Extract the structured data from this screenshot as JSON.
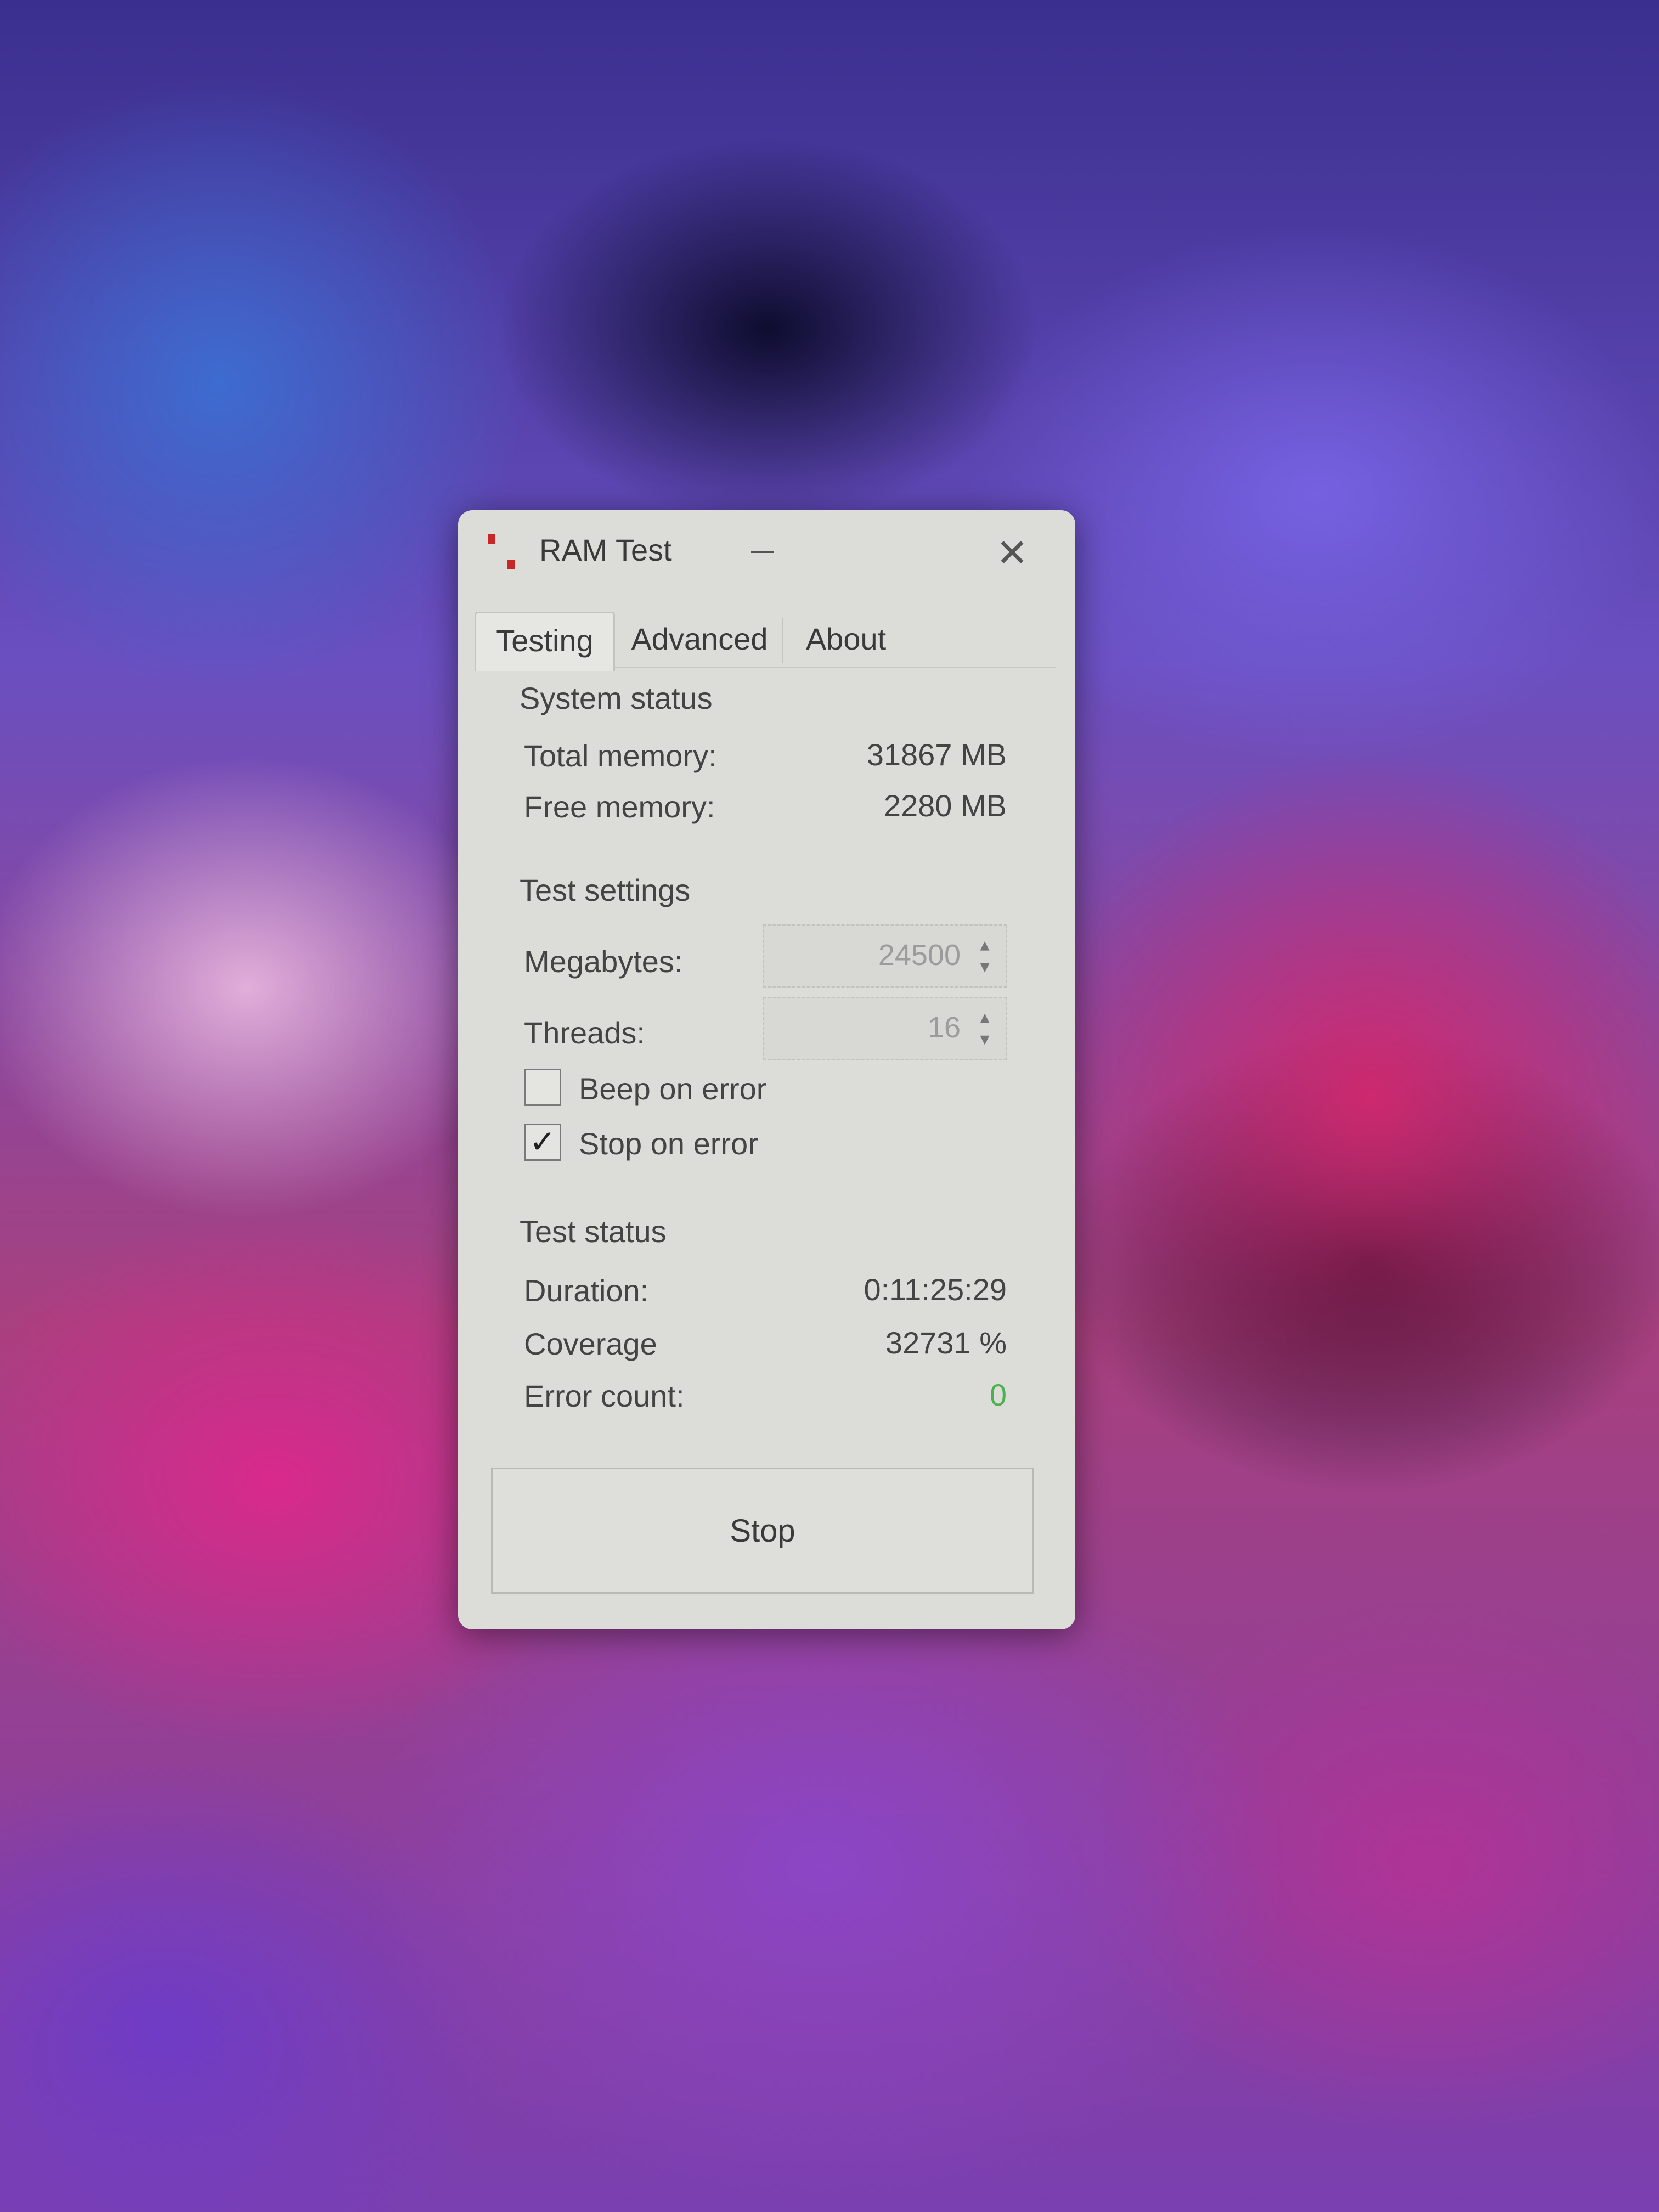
{
  "window": {
    "title": "RAM Test",
    "close_glyph": "✕"
  },
  "tabs": [
    {
      "label": "Testing",
      "active": true
    },
    {
      "label": "Advanced",
      "active": false
    },
    {
      "label": "About",
      "active": false
    }
  ],
  "system_status": {
    "title": "System status",
    "total_memory_label": "Total memory:",
    "total_memory_value": "31867 MB",
    "free_memory_label": "Free memory:",
    "free_memory_value": "2280 MB"
  },
  "test_settings": {
    "title": "Test settings",
    "megabytes_label": "Megabytes:",
    "megabytes_value": "24500",
    "threads_label": "Threads:",
    "threads_value": "16",
    "spin_arrows": "▴\n▾",
    "beep_on_error_label": "Beep on error",
    "beep_on_error_checked": false,
    "stop_on_error_label": "Stop on error",
    "stop_on_error_checked": true,
    "check_glyph": "✓"
  },
  "test_status": {
    "title": "Test status",
    "duration_label": "Duration:",
    "duration_value": "0:11:25:29",
    "coverage_label": "Coverage",
    "coverage_value": "32731 %",
    "error_count_label": "Error count:",
    "error_count_value": "0",
    "error_count_color": "#4caf50"
  },
  "actions": {
    "stop_label": "Stop"
  },
  "icons": [
    "ram-test-app-icon",
    "minimize-icon",
    "close-icon",
    "spin-arrows-icon",
    "checkmark-icon"
  ]
}
